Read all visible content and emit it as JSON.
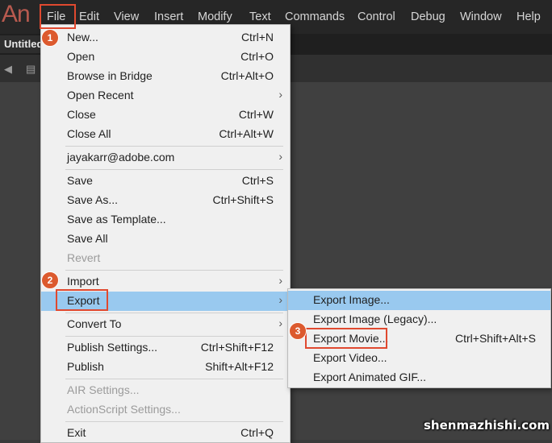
{
  "app": {
    "logo": "An"
  },
  "menubar": {
    "items": [
      "File",
      "Edit",
      "View",
      "Insert",
      "Modify",
      "Text",
      "Commands",
      "Control",
      "Debug",
      "Window",
      "Help"
    ]
  },
  "document": {
    "tab_title": "Untitled"
  },
  "file_menu": {
    "new": {
      "label": "New...",
      "shortcut": "Ctrl+N"
    },
    "open": {
      "label": "Open",
      "shortcut": "Ctrl+O"
    },
    "browse": {
      "label": "Browse in Bridge",
      "shortcut": "Ctrl+Alt+O"
    },
    "open_recent": {
      "label": "Open Recent"
    },
    "close": {
      "label": "Close",
      "shortcut": "Ctrl+W"
    },
    "close_all": {
      "label": "Close All",
      "shortcut": "Ctrl+Alt+W"
    },
    "account": {
      "label": "jayakarr@adobe.com"
    },
    "save": {
      "label": "Save",
      "shortcut": "Ctrl+S"
    },
    "save_as": {
      "label": "Save As...",
      "shortcut": "Ctrl+Shift+S"
    },
    "save_template": {
      "label": "Save as Template..."
    },
    "save_all": {
      "label": "Save All"
    },
    "revert": {
      "label": "Revert"
    },
    "import": {
      "label": "Import"
    },
    "export": {
      "label": "Export"
    },
    "convert_to": {
      "label": "Convert To"
    },
    "publish_settings": {
      "label": "Publish Settings...",
      "shortcut": "Ctrl+Shift+F12"
    },
    "publish": {
      "label": "Publish",
      "shortcut": "Shift+Alt+F12"
    },
    "air_settings": {
      "label": "AIR Settings..."
    },
    "actionscript_settings": {
      "label": "ActionScript Settings..."
    },
    "exit": {
      "label": "Exit",
      "shortcut": "Ctrl+Q"
    }
  },
  "export_submenu": {
    "image": {
      "label": "Export Image..."
    },
    "image_legacy": {
      "label": "Export Image (Legacy)..."
    },
    "movie": {
      "label": "Export Movie...",
      "shortcut": "Ctrl+Shift+Alt+S"
    },
    "video": {
      "label": "Export Video..."
    },
    "gif": {
      "label": "Export Animated GIF..."
    }
  },
  "step_badges": [
    "1",
    "2",
    "3"
  ],
  "watermark": "shenmazhishi.com",
  "colors": {
    "highlight": "#99c9ef",
    "annotation": "#e0492f",
    "badge": "#dc5a2e",
    "logo": "#b85a4f"
  }
}
